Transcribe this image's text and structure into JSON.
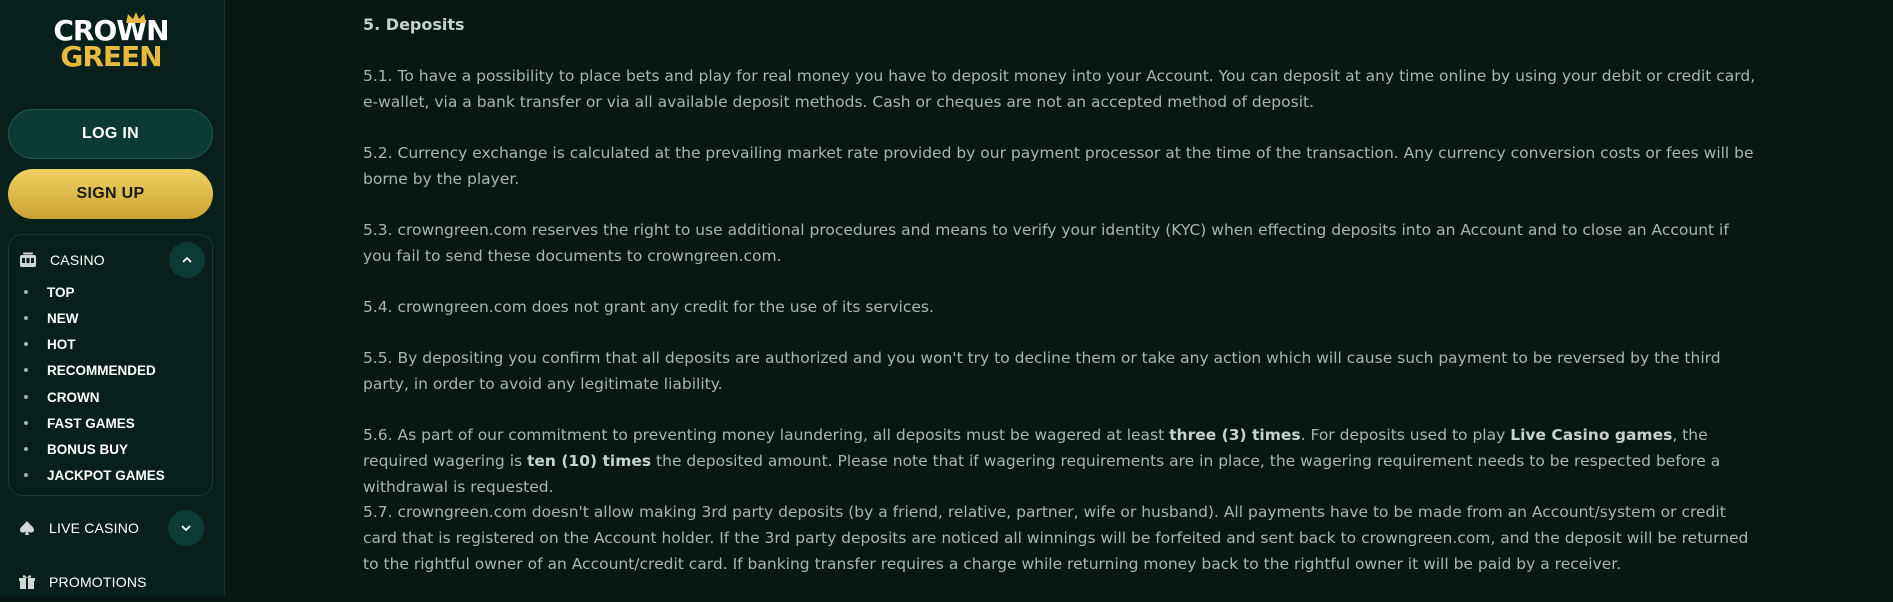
{
  "logo": {
    "line1": "CROWN",
    "line2": "GREEN"
  },
  "auth": {
    "login_label": "LOG IN",
    "signup_label": "SIGN UP"
  },
  "sidebar": {
    "casino": {
      "label": "CASINO",
      "items": [
        "TOP",
        "NEW",
        "HOT",
        "RECOMMENDED",
        "CROWN",
        "FAST GAMES",
        "BONUS BUY",
        "JACKPOT GAMES"
      ]
    },
    "live_casino": {
      "label": "LIVE CASINO"
    },
    "promotions": {
      "label": "PROMOTIONS"
    }
  },
  "section": {
    "heading": "5. Deposits",
    "p1": "5.1. To have a possibility to place bets and play for real money you have to deposit money into your Account. You can deposit at any time online by using your debit or credit card, e-wallet, via a bank transfer or via all available deposit methods. Cash or cheques are not an accepted method of deposit.",
    "p2": "5.2. Currency exchange is calculated at the prevailing market rate provided by our payment processor at the time of the transaction. Any currency conversion costs or fees will be borne by the player.",
    "p3": "5.3. crowngreen.com reserves the right to use additional procedures and means to verify your identity (KYC) when effecting deposits into an Account and to close an Account if you fail to send these documents to crowngreen.com.",
    "p4": "5.4. crowngreen.com does not grant any credit for the use of its services.",
    "p5": "5.5. By depositing you confirm that all deposits are authorized and you won't try to decline them or take any action which will cause such payment to be reversed by the third party, in order to avoid any legitimate liability.",
    "p6": {
      "a": "5.6. As part of our commitment to preventing money laundering, all deposits must be wagered at least ",
      "b1": "three (3) times",
      "c": ". For deposits used to play ",
      "b2": "Live Casino games",
      "d": ", the required wagering is ",
      "b3": "ten (10) times",
      "e": " the deposited amount. Please note that if wagering requirements are in place, the wagering requirement needs to be respected before a withdrawal is requested."
    },
    "p7": "5.7. crowngreen.com doesn't allow making 3rd party deposits (by a friend, relative, partner, wife or husband). All payments have to be made from an Account/system or credit card that is registered on the Account holder. If the 3rd party deposits are noticed all winnings will be forfeited and sent back to crowngreen.com, and the deposit will be returned to the rightful owner of an Account/credit card. If banking transfer requires a charge while returning money back to the rightful owner it will be paid by a receiver."
  },
  "colors": {
    "accent_gold": "#e7b93e",
    "sidebar_bg": "#07201c",
    "page_bg": "#061714"
  },
  "icons": [
    "crown-icon",
    "slot-machine-icon",
    "chevron-up-icon",
    "chevron-down-icon",
    "spade-icon",
    "gift-icon"
  ]
}
